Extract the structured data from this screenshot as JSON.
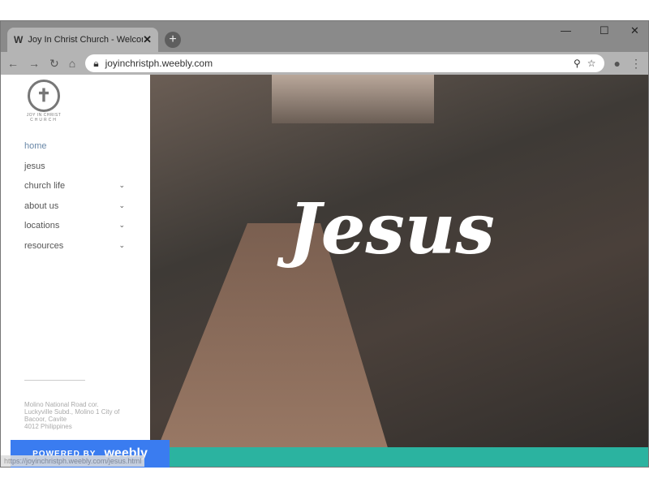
{
  "browser": {
    "tab_title": "Joy In Christ Church - Welcome t",
    "tab_icon": "weebly-w-icon",
    "favicon_letter": "W",
    "url": "joyinchristph.weebly.com",
    "status_url": "https://joyinchristph.weebly.com/jesus.html"
  },
  "logo": {
    "text_top": "JOY IN CHRIST",
    "text_bottom": "CHURCH"
  },
  "nav": [
    {
      "label": "home",
      "active": true
    },
    {
      "label": "jesus"
    },
    {
      "label": "church life",
      "dropdown": true
    },
    {
      "label": "about us",
      "dropdown": true
    },
    {
      "label": "locations",
      "dropdown": true
    },
    {
      "label": "resources",
      "dropdown": true
    }
  ],
  "address": [
    "Molino National Road cor.",
    "Luckyville Subd., Molino 1 City of",
    "Bacoor, Cavite",
    "4012 Philippines"
  ],
  "hero": {
    "title": "Jesus"
  },
  "badge": {
    "powered": "POWERED BY",
    "brand": "weebly"
  },
  "colors": {
    "accent": "#6a88a8",
    "weebly": "#3a7cf0",
    "teal": "#2bb3a0"
  }
}
